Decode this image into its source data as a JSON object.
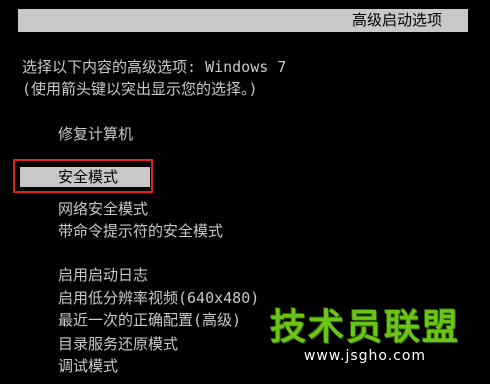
{
  "window": {
    "title": "高级启动选项"
  },
  "prompt": {
    "line1": "选择以下内容的高级选项: Windows 7",
    "line2": "(使用箭头键以突出显示您的选择。)"
  },
  "menu": {
    "repair": "修复计算机",
    "safe_modes": [
      "安全模式",
      "网络安全模式",
      "带命令提示符的安全模式"
    ],
    "other_options": [
      "启用启动日志",
      "启用低分辨率视频(640x480)",
      "最近一次的正确配置(高级)",
      "目录服务还原模式",
      "调试模式"
    ],
    "selected_index": 0
  },
  "annotation": {
    "highlight_color": "#e0211f"
  },
  "watermark": {
    "name": "技术员联盟",
    "url": "www.jsgho.com",
    "color": "#6cc516"
  },
  "colors": {
    "background": "#000000",
    "text": "#c8c8c8",
    "selection_background": "#c8c8c8",
    "selection_text": "#000000"
  }
}
